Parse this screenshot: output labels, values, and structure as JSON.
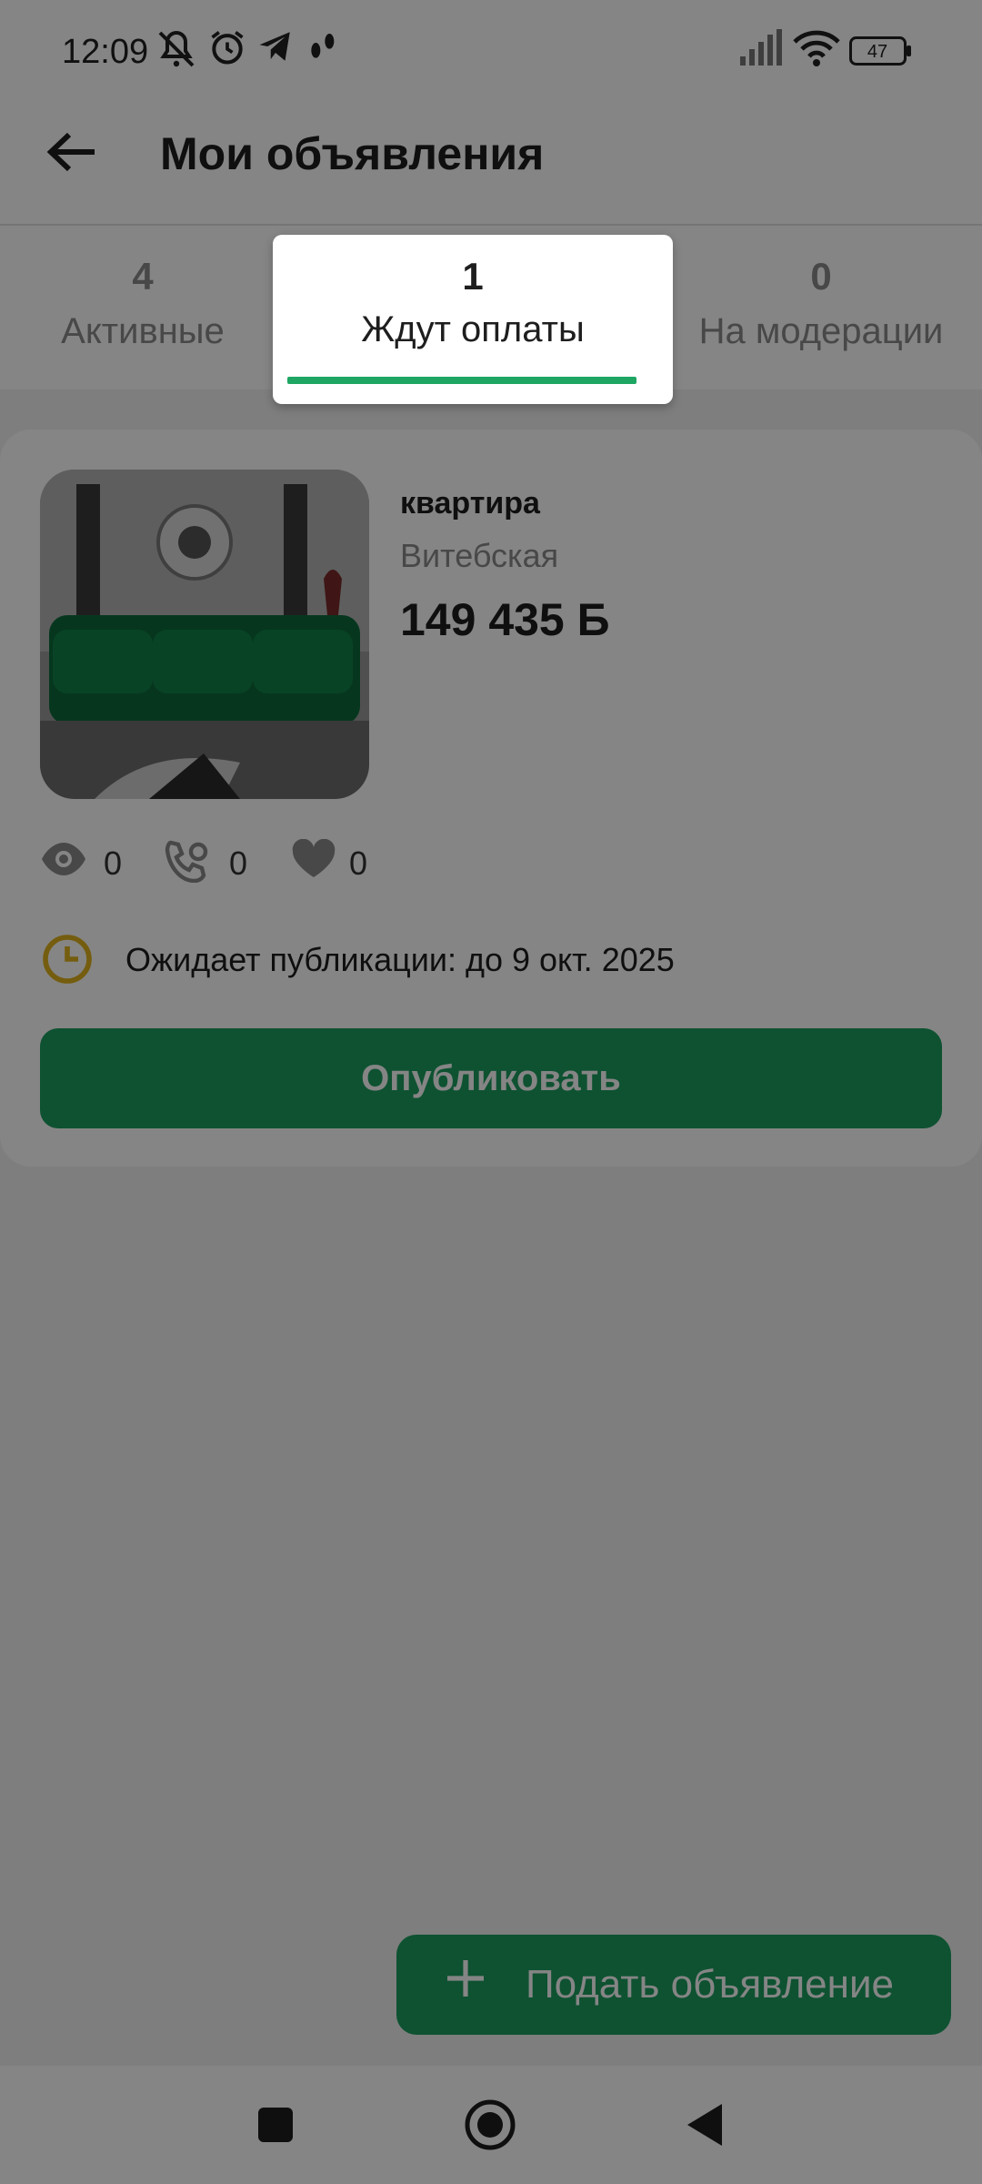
{
  "status_bar": {
    "time": "12:09",
    "left_icons": [
      "mute-bell-icon",
      "alarm-icon",
      "telegram-icon",
      "footsteps-icon"
    ],
    "right_icons": [
      "signal-icon",
      "wifi-icon",
      "battery-icon"
    ],
    "battery": "47"
  },
  "header": {
    "title": "Мои объявления",
    "back_icon": "arrow-back-icon"
  },
  "tabs": [
    {
      "count": "4",
      "label": "Активные"
    },
    {
      "count": "1",
      "label": "Ждут оплаты",
      "active": true
    },
    {
      "count": "0",
      "label": "На модерации"
    }
  ],
  "listing": {
    "title": "квартира",
    "location": "Витебская",
    "price": "149 435",
    "currency": "Б",
    "stats": [
      {
        "icon": "eye-icon",
        "value": "0"
      },
      {
        "icon": "phone-call-icon",
        "value": "0"
      },
      {
        "icon": "heart-icon",
        "value": "0"
      }
    ],
    "status_icon": "clock-icon",
    "status_text": "Ожидает публикации: до 9 окт. 2025",
    "publish_label": "Опубликовать"
  },
  "fab": {
    "icon": "plus-icon",
    "label": "Подать объявление"
  },
  "navbar": {
    "icons": [
      "recents-square-icon",
      "home-circle-icon",
      "back-triangle-icon"
    ]
  },
  "colors": {
    "accent": "#1b9e5e",
    "tab_indicator": "#1fa663",
    "clock": "#e0b21e",
    "muted_text": "#8a8a8a"
  }
}
